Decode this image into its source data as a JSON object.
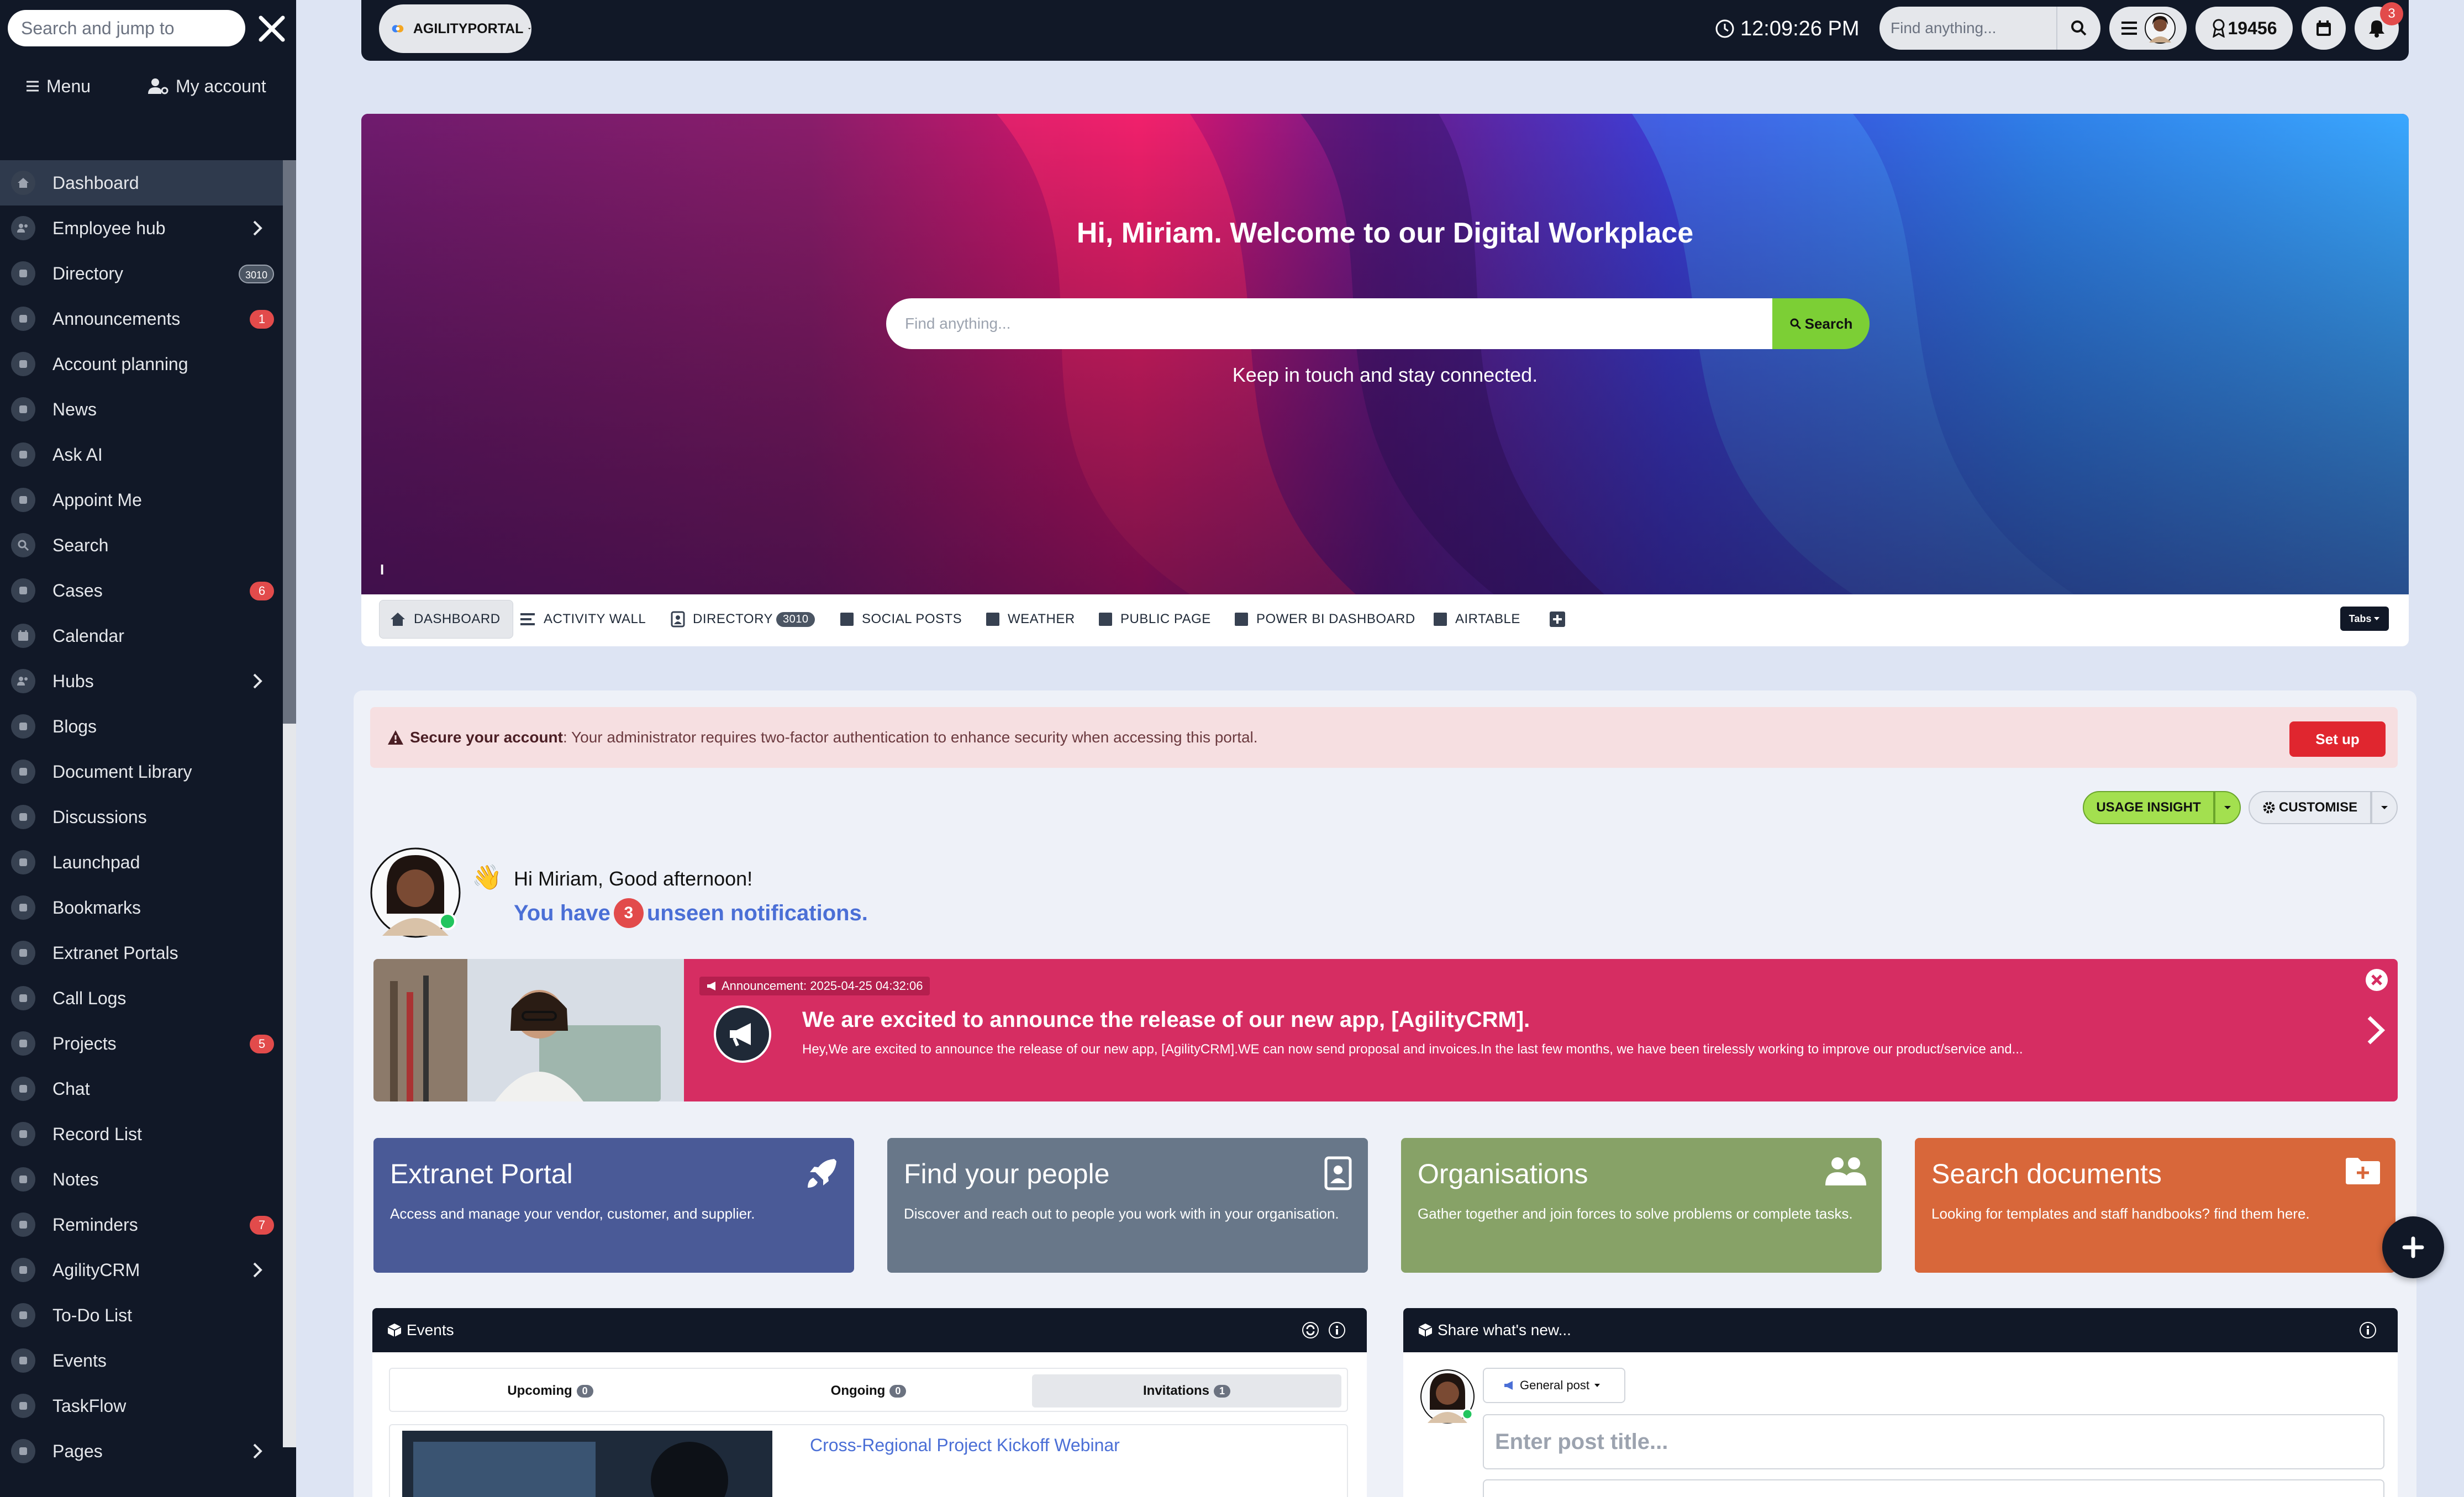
{
  "sidebar": {
    "search_placeholder": "Search and jump to",
    "menu_label": "Menu",
    "account_label": "My account",
    "items": [
      {
        "label": "Dashboard",
        "icon": "home-icon",
        "active": true
      },
      {
        "label": "Employee hub",
        "icon": "people-icon",
        "chevron": true
      },
      {
        "label": "Directory",
        "icon": "directory-icon",
        "badge": "3010"
      },
      {
        "label": "Announcements",
        "icon": "megaphone-icon",
        "badge": "1"
      },
      {
        "label": "Account planning",
        "icon": "id-card-icon"
      },
      {
        "label": "News",
        "icon": "news-icon"
      },
      {
        "label": "Ask AI",
        "icon": "robot-icon"
      },
      {
        "label": "Appoint Me",
        "icon": "calendar-book-icon"
      },
      {
        "label": "Search",
        "icon": "search-icon"
      },
      {
        "label": "Cases",
        "icon": "life-ring-icon",
        "badge": "6"
      },
      {
        "label": "Calendar",
        "icon": "calendar-icon"
      },
      {
        "label": "Hubs",
        "icon": "users-icon",
        "chevron": true
      },
      {
        "label": "Blogs",
        "icon": "blog-icon"
      },
      {
        "label": "Document Library",
        "icon": "folder-icon"
      },
      {
        "label": "Discussions",
        "icon": "comment-icon"
      },
      {
        "label": "Launchpad",
        "icon": "rocket-icon"
      },
      {
        "label": "Bookmarks",
        "icon": "bookmark-icon"
      },
      {
        "label": "Extranet Portals",
        "icon": "portal-icon"
      },
      {
        "label": "Call Logs",
        "icon": "phone-icon"
      },
      {
        "label": "Projects",
        "icon": "project-icon",
        "badge": "5"
      },
      {
        "label": "Chat",
        "icon": "chat-icon"
      },
      {
        "label": "Record List",
        "icon": "table-icon"
      },
      {
        "label": "Notes",
        "icon": "note-icon"
      },
      {
        "label": "Reminders",
        "icon": "stopwatch-icon",
        "badge": "7"
      },
      {
        "label": "AgilityCRM",
        "icon": "crm-icon",
        "chevron": true
      },
      {
        "label": "To-Do List",
        "icon": "list-icon"
      },
      {
        "label": "Events",
        "icon": "events-icon"
      },
      {
        "label": "TaskFlow",
        "icon": "taskflow-icon"
      },
      {
        "label": "Pages",
        "icon": "page-icon",
        "chevron": true
      }
    ]
  },
  "topbar": {
    "portal_name": "AGILITYPORTAL",
    "clock": "12:09:26 PM",
    "find_placeholder": "Find anything...",
    "score": "19456",
    "notification_count": "3"
  },
  "hero": {
    "title": "Hi, Miriam. Welcome to our Digital Workplace",
    "search_placeholder": "Find anything...",
    "search_button": "Search",
    "subtitle": "Keep in touch and stay connected.",
    "info_glyph": "I"
  },
  "tabs": {
    "items": [
      {
        "label": "DASHBOARD",
        "icon": "home-icon",
        "active": true
      },
      {
        "label": "ACTIVITY WALL",
        "icon": "list-lines-icon"
      },
      {
        "label": "DIRECTORY",
        "icon": "directory-icon",
        "count": "3010"
      },
      {
        "label": "SOCIAL POSTS",
        "icon": "square-icon"
      },
      {
        "label": "WEATHER",
        "icon": "square-icon"
      },
      {
        "label": "PUBLIC PAGE",
        "icon": "square-icon"
      },
      {
        "label": "POWER BI DASHBOARD",
        "icon": "square-icon"
      },
      {
        "label": "AIRTABLE",
        "icon": "square-icon"
      }
    ],
    "tabs_dropdown": "Tabs"
  },
  "alert": {
    "title": "Secure your account",
    "message": ": Your administrator requires two-factor authentication to enhance security when accessing this portal.",
    "button": "Set up"
  },
  "actions": {
    "usage": "USAGE INSIGHT",
    "customise": "CUSTOMISE"
  },
  "greeting": {
    "wave": "👋",
    "line": "Hi Miriam, Good afternoon!",
    "notif_prefix": "You have",
    "notif_count": "3",
    "notif_suffix": "unseen notifications."
  },
  "announcement": {
    "tag": "Announcement: 2025-04-25 04:32:06",
    "title": "We are excited to announce the release of our new app, [AgilityCRM].",
    "body": "Hey,We are excited to announce the release of our new app, [AgilityCRM].WE can now send proposal and invoices.In the last few months, we have been tirelessly working to improve our product/service and..."
  },
  "tiles": [
    {
      "title": "Extranet Portal",
      "desc": "Access and manage your vendor, customer, and supplier.",
      "color": "#4a5a97",
      "icon": "rocket-icon"
    },
    {
      "title": "Find your people",
      "desc": "Discover and reach out to people you work with in your organisation.",
      "color": "#687789",
      "icon": "contact-card-icon"
    },
    {
      "title": "Organisations",
      "desc": "Gather together and join forces to solve problems or complete tasks.",
      "color": "#87a267",
      "icon": "users-icon"
    },
    {
      "title": "Search documents",
      "desc": "Looking for templates and staff handbooks? find them here.",
      "color": "#d8673a",
      "icon": "folder-plus-icon"
    }
  ],
  "events": {
    "title": "Events",
    "tabs": [
      {
        "label": "Upcoming",
        "count": "0"
      },
      {
        "label": "Ongoing",
        "count": "0"
      },
      {
        "label": "Invitations",
        "count": "1"
      }
    ],
    "first_event": "Cross-Regional Project Kickoff Webinar"
  },
  "share": {
    "title": "Share what's new...",
    "post_type": "General post",
    "title_placeholder": "Enter post title..."
  },
  "colors": {
    "sidebar_bg": "#111827",
    "accent_green": "#7ccf35",
    "announcement": "#d62d62",
    "alert_red": "#e0262f",
    "link_blue": "#4b6fd6"
  }
}
